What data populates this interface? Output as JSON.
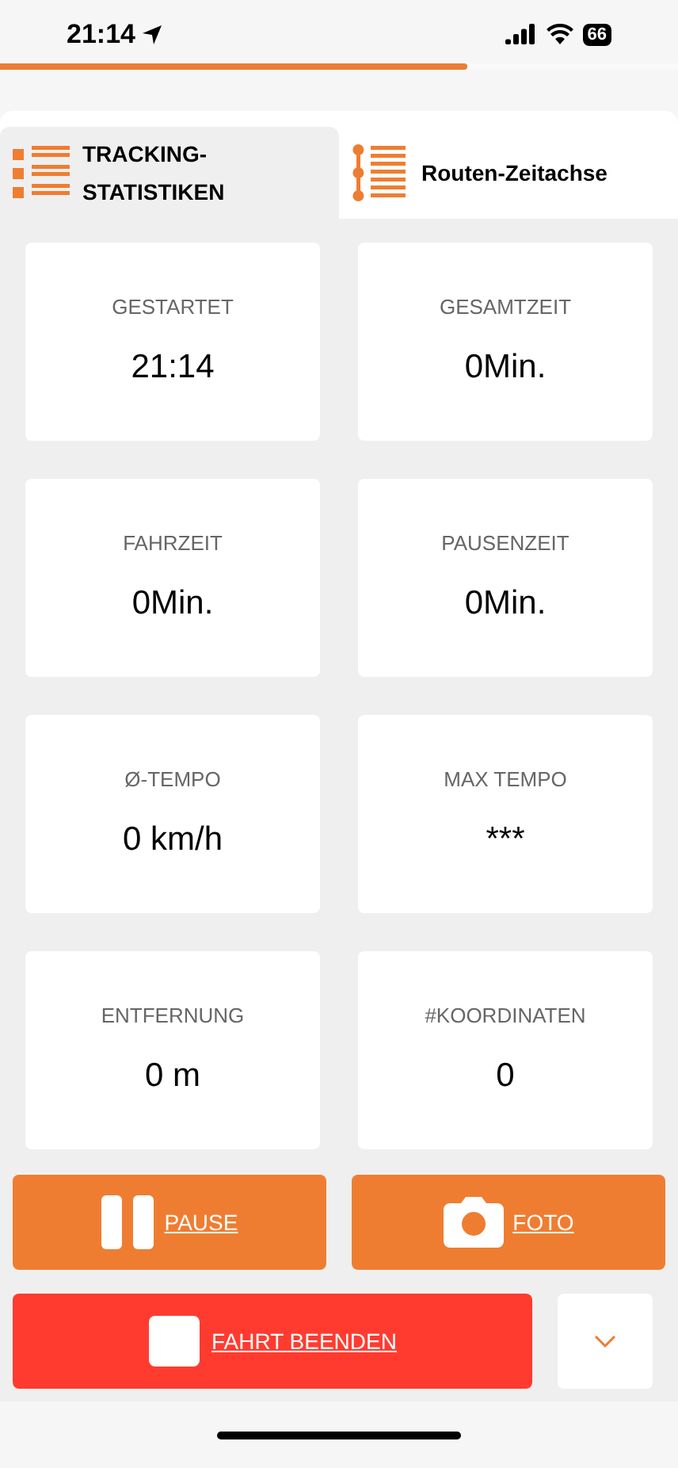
{
  "status_bar": {
    "time": "21:14",
    "battery": "66"
  },
  "progress": {
    "level": 0.69
  },
  "tabs": [
    {
      "label": "TRACKING-STATISTIKEN",
      "kind": "stats",
      "selected": true
    },
    {
      "label": "Routen-Zeitachse",
      "kind": "timeline",
      "selected": false
    }
  ],
  "stats": [
    {
      "label": "GESTARTET",
      "value": "21:14"
    },
    {
      "label": "GESAMTZEIT",
      "value": "0Min."
    },
    {
      "label": "FAHRZEIT",
      "value": "0Min."
    },
    {
      "label": "PAUSENZEIT",
      "value": "0Min."
    },
    {
      "label": "Ø-TEMPO",
      "value": "0 km/h"
    },
    {
      "label": "MAX TEMPO",
      "value": "***"
    },
    {
      "label": "ENTFERNUNG",
      "value": "0 m"
    },
    {
      "label": "#KOORDINATEN",
      "value": "0"
    }
  ],
  "actions": [
    {
      "label": "PAUSE",
      "kind": "pause"
    },
    {
      "label": "FOTO",
      "kind": "photo"
    },
    {
      "label": "FAHRT BEENDEN",
      "kind": "stop"
    }
  ]
}
